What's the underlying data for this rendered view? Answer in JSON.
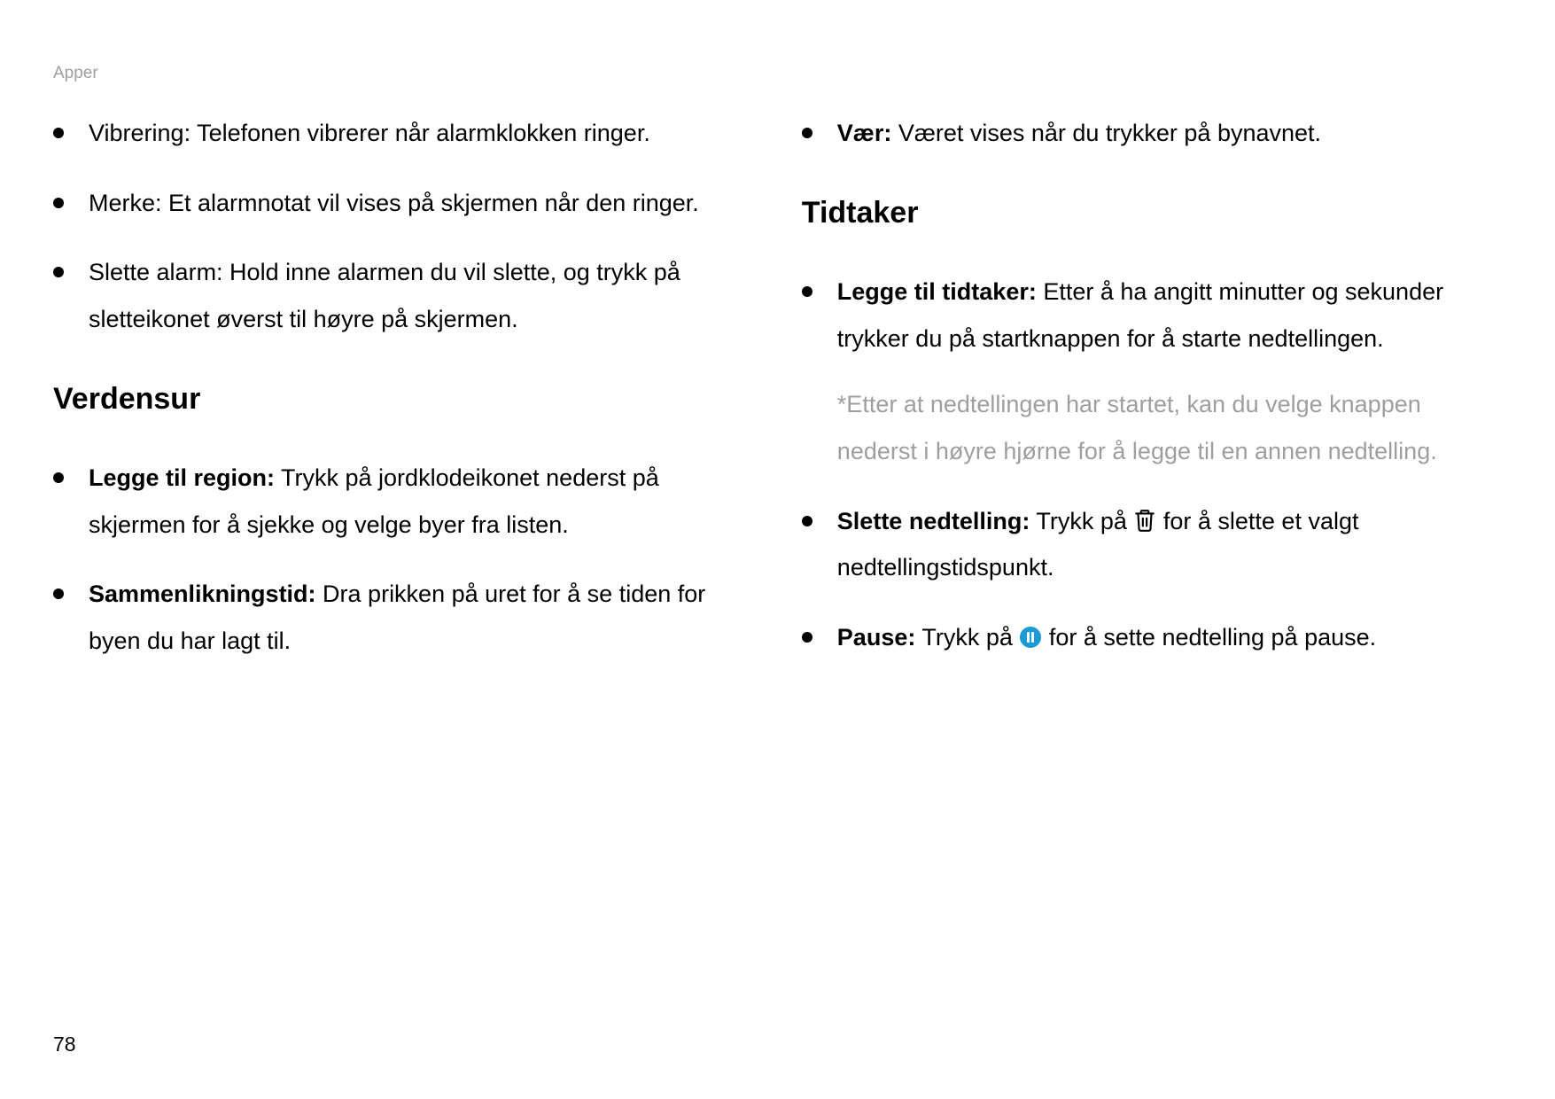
{
  "header": {
    "section_label": "Apper"
  },
  "page_number": "78",
  "left": {
    "items_top": [
      {
        "text": "Vibrering: Telefonen vibrerer når alarmklokken ringer."
      },
      {
        "text": "Merke: Et alarmnotat vil vises på skjermen når den ringer."
      },
      {
        "text": "Slette alarm: Hold inne alarmen du vil slette, og trykk på sletteikonet øverst til høyre på skjermen."
      }
    ],
    "heading": "Verdensur",
    "items_bottom": [
      {
        "label": "Legge til region:",
        "text": " Trykk på jordklodeikonet nederst på skjermen for å sjekke og velge byer fra listen."
      },
      {
        "label": "Sammenlikningstid:",
        "text": " Dra prikken på uret for å se tiden for byen du har lagt til."
      }
    ]
  },
  "right": {
    "items_top": [
      {
        "label": "Vær:",
        "text": " Været vises når du trykker på bynavnet."
      }
    ],
    "heading": "Tidtaker",
    "item_add": {
      "label": "Legge til tidtaker:",
      "text": " Etter å ha angitt minutter og sekunder trykker du på startknappen for å starte nedtellingen."
    },
    "note": "*Etter at nedtellingen har startet, kan du velge knappen nederst i høyre hjørne for å legge til en annen nedtelling.",
    "item_delete": {
      "label": "Slette nedtelling:",
      "pre": " Trykk på ",
      "post": " for å slette et valgt nedtellingstidspunkt."
    },
    "item_pause": {
      "label": "Pause:",
      "pre": " Trykk på ",
      "post": " for å sette nedtelling på pause."
    }
  }
}
